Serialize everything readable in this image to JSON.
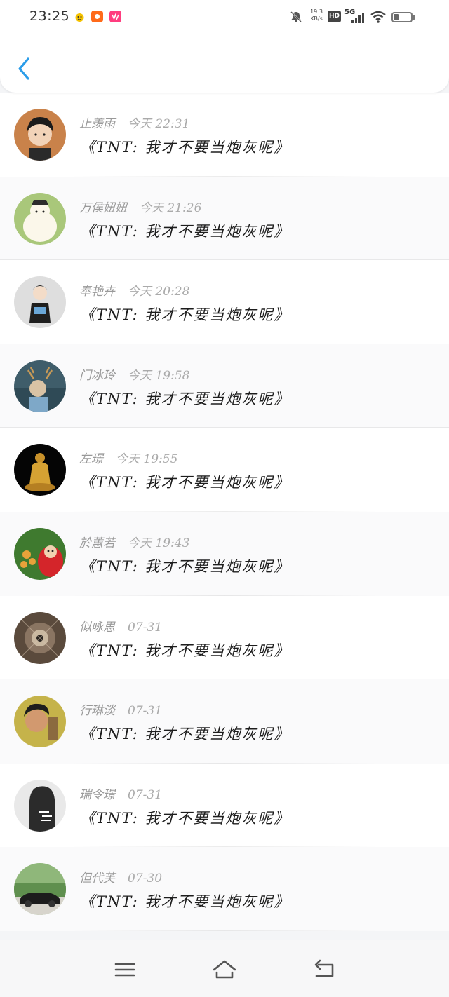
{
  "status_bar": {
    "time": "23:25",
    "net_speed_value": "19.3",
    "net_speed_unit": "KB/s",
    "hd_label": "HD",
    "network_label": "5G",
    "battery_level": 0.35
  },
  "header": {
    "back_icon": "chevron-left-icon",
    "accent_color": "#2b9de9"
  },
  "comments": [
    {
      "name": "止羡雨",
      "time": "今天 22:31",
      "title": "《TNT: 我才不要当炮灰呢》"
    },
    {
      "name": "万侯妞妞",
      "time": "今天 21:26",
      "title": "《TNT: 我才不要当炮灰呢》"
    },
    {
      "name": "奉艳卉",
      "time": "今天 20:28",
      "title": "《TNT: 我才不要当炮灰呢》"
    },
    {
      "name": "门冰玲",
      "time": "今天 19:58",
      "title": "《TNT: 我才不要当炮灰呢》"
    },
    {
      "name": "左璟",
      "time": "今天 19:55",
      "title": "《TNT: 我才不要当炮灰呢》"
    },
    {
      "name": "於蕙若",
      "time": "今天 19:43",
      "title": "《TNT: 我才不要当炮灰呢》"
    },
    {
      "name": "似咏思",
      "time": "07-31",
      "title": "《TNT: 我才不要当炮灰呢》"
    },
    {
      "name": "行琳淡",
      "time": "07-31",
      "title": "《TNT: 我才不要当炮灰呢》"
    },
    {
      "name": "瑞令璟",
      "time": "07-31",
      "title": "《TNT: 我才不要当炮灰呢》"
    },
    {
      "name": "但代芙",
      "time": "07-30",
      "title": "《TNT: 我才不要当炮灰呢》"
    }
  ],
  "nav_bar": {
    "menu_icon": "menu-icon",
    "home_icon": "home-icon",
    "back_icon": "back-arrow-icon"
  }
}
